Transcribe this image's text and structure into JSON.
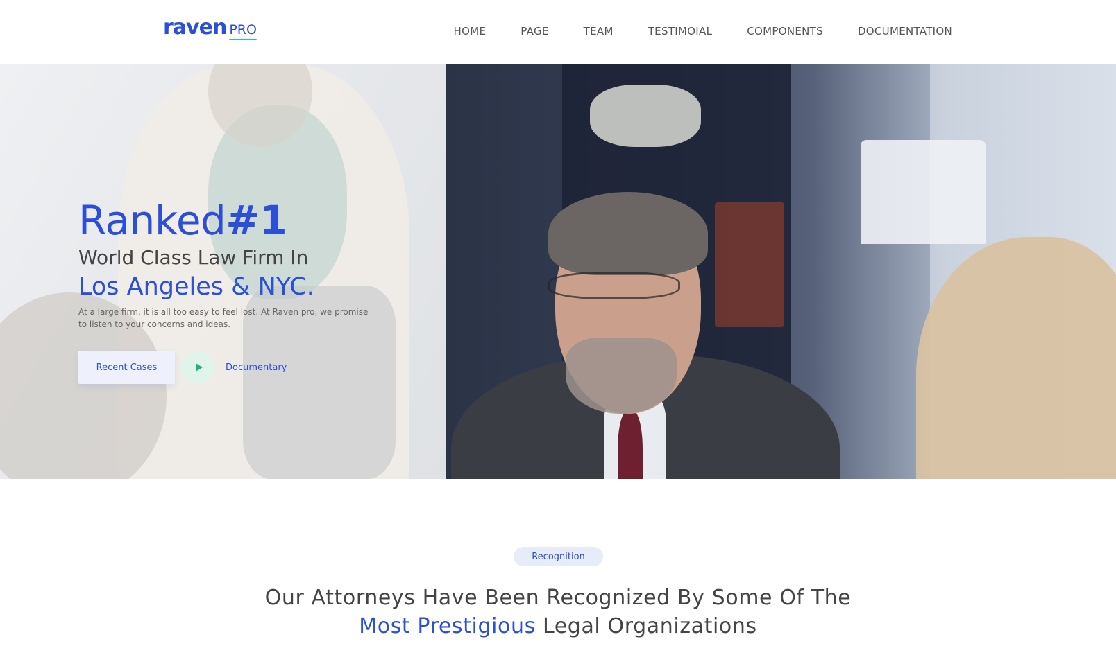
{
  "brand": {
    "name": "raven",
    "suffix": "PRO",
    "color": "#2b4fd6",
    "underline_color": "#2bc4a0"
  },
  "nav": {
    "items": [
      {
        "label": "HOME"
      },
      {
        "label": "PAGE"
      },
      {
        "label": "TEAM"
      },
      {
        "label": "TESTIMOIAL"
      },
      {
        "label": "COMPONENTS"
      },
      {
        "label": "DOCUMENTATION"
      }
    ]
  },
  "hero": {
    "title_prefix": "Ranked",
    "title_number": "#1",
    "subtitle": "World Class Law Firm In",
    "location": "Los Angeles & NYC.",
    "description": "At a large firm, it is all too easy to feel lost. At Raven pro, we promise to listen to your concerns and ideas.",
    "primary_button": "Recent Cases",
    "play_icon": "play-icon",
    "video_link": "Documentary"
  },
  "recognition": {
    "badge": "Recognition",
    "line1": "Our Attorneys Have Been Recognized By Some Of The",
    "line2_accent": "Most Prestigious",
    "line2_rest": " Legal Organizations"
  },
  "colors": {
    "accent": "#2b4fd6",
    "play": "#22b07d",
    "play_bg": "#dff5ec",
    "badge_bg": "#e6ecf8"
  }
}
